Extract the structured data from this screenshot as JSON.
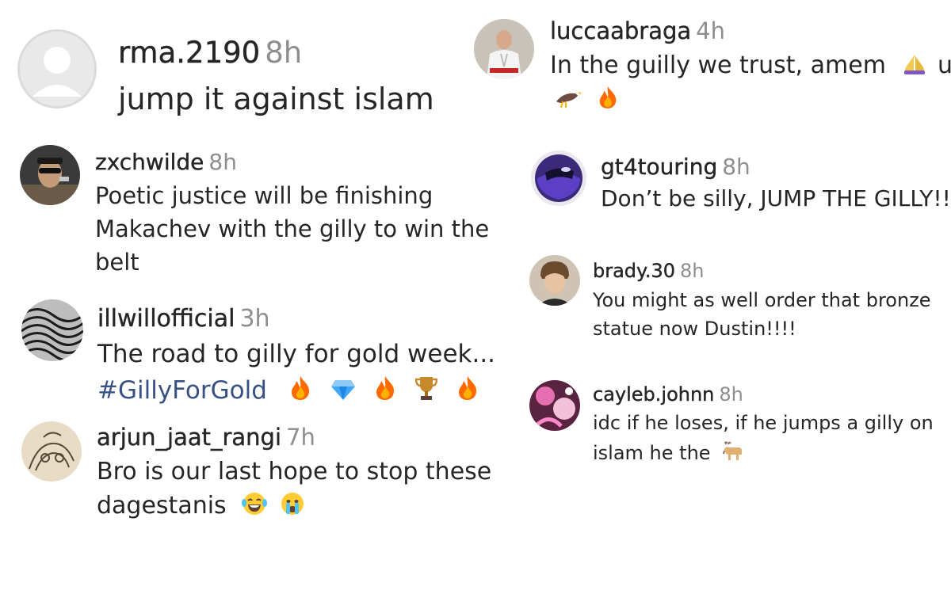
{
  "comments": [
    {
      "id": "rma",
      "username": "rma.2190",
      "time": "8h",
      "lines": [
        "jump it against islam"
      ]
    },
    {
      "id": "zxc",
      "username": "zxchwilde",
      "time": "8h",
      "lines": [
        "Poetic justice will be finishing",
        "Makachev with the gilly to win the",
        "belt"
      ]
    },
    {
      "id": "illwill",
      "username": "illwillofficial",
      "time": "3h",
      "lines": [
        "The road to gilly for gold week..."
      ],
      "hashtag": "#GillyForGold",
      "emojis": [
        "fire-emoji",
        "diamond-emoji",
        "fire-emoji",
        "trophy-emoji",
        "fire-emoji"
      ]
    },
    {
      "id": "arjun",
      "username": "arjun_jaat_rangi",
      "time": "7h",
      "lines": [
        "Bro is our last hope to stop these",
        "dagestanis"
      ],
      "emojis": [
        "laughing-tears-emoji",
        "crying-emoji"
      ]
    },
    {
      "id": "lucca",
      "username": "luccaabraga",
      "time": "4h",
      "lines": [
        "In the guilly we trust, amem",
        "us"
      ],
      "emojis": [
        "praying-hands-emoji",
        "eagle-emoji",
        "fire-emoji"
      ]
    },
    {
      "id": "gt4",
      "username": "gt4touring",
      "time": "8h",
      "lines": [
        "Don’t be silly, JUMP THE GILLY!!!"
      ]
    },
    {
      "id": "brady",
      "username": "brady.30",
      "time": "8h",
      "lines": [
        "You might as well order that bronze",
        "statue now Dustin!!!!"
      ]
    },
    {
      "id": "cayleb",
      "username": "cayleb.johnn",
      "time": "8h",
      "lines": [
        "idc if he loses, if he jumps a gilly on",
        "islam he the"
      ],
      "emojis": [
        "goat-emoji"
      ]
    }
  ]
}
